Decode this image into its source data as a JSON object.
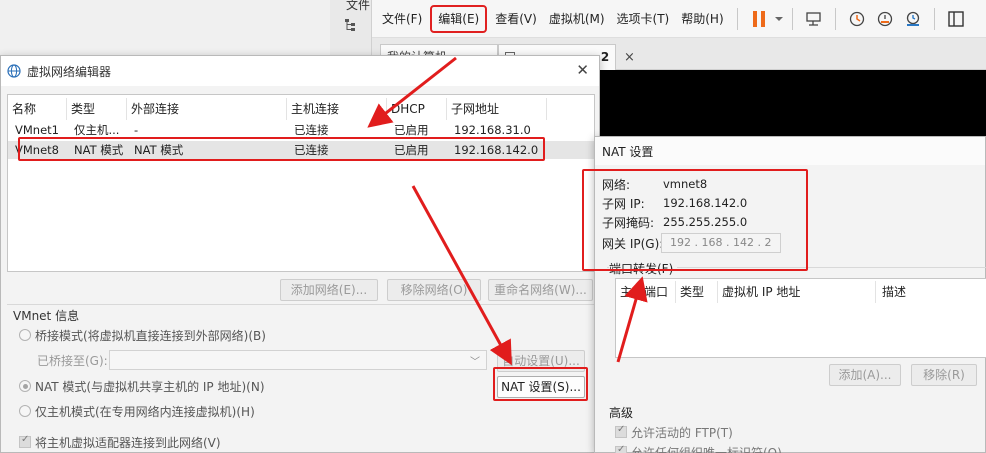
{
  "vmware": {
    "left_strip_top_word": "文件",
    "menu": [
      "文件(F)",
      "编辑(E)",
      "查看(V)",
      "虚拟机(M)",
      "选项卡(T)",
      "帮助(H)"
    ],
    "highlighted_menu": "编辑(E)",
    "tabs": [
      "我的计算机",
      "2"
    ],
    "tab_close_glyph": "×",
    "colors": {
      "pause": "#ee6a1a",
      "accent": "#e11d1d"
    }
  },
  "vne": {
    "title": "虚拟网络编辑器",
    "columns": [
      "名称",
      "类型",
      "外部连接",
      "主机连接",
      "DHCP",
      "子网地址"
    ],
    "rows": [
      {
        "name": "VMnet1",
        "type": "仅主机...",
        "external": "-",
        "host": "已连接",
        "dhcp": "已启用",
        "subnet": "192.168.31.0"
      },
      {
        "name": "VMnet8",
        "type": "NAT 模式",
        "external": "NAT 模式",
        "host": "已连接",
        "dhcp": "已启用",
        "subnet": "192.168.142.0"
      }
    ],
    "buttons": {
      "add_network": "添加网络(E)...",
      "remove_network": "移除网络(O)",
      "rename_network": "重命名网络(W)..."
    },
    "info": {
      "legend": "VMnet 信息",
      "bridge_mode": "桥接模式(将虚拟机直接连接到外部网络)(B)",
      "bridged_to": "已桥接至(G):",
      "auto_settings": "自动设置(U)...",
      "nat_mode": "NAT 模式(与虚拟机共享主机的 IP 地址)(N)",
      "nat_settings": "NAT 设置(S)...",
      "host_only_mode": "仅主机模式(在专用网络内连接虚拟机)(H)",
      "connect_adapter": "将主机虚拟适配器连接到此网络(V)"
    }
  },
  "nat": {
    "title": "NAT 设置",
    "network_label": "网络:",
    "network_value": "vmnet8",
    "subnet_ip_label": "子网 IP:",
    "subnet_ip_value": "192.168.142.0",
    "subnet_mask_label": "子网掩码:",
    "subnet_mask_value": "255.255.255.0",
    "gateway_label": "网关 IP(G):",
    "gateway_value": "192 . 168 . 142 .  2",
    "port_forwarding": {
      "legend": "端口转发(F)",
      "columns": [
        "主机端口",
        "类型",
        "虚拟机 IP 地址",
        "描述"
      ],
      "add_button": "添加(A)...",
      "remove_button": "移除(R)"
    },
    "advanced": {
      "legend": "高级",
      "allow_ftp": "允许活动的 FTP(T)",
      "allow_oui": "允许任何组织唯一标识符(O)"
    }
  }
}
